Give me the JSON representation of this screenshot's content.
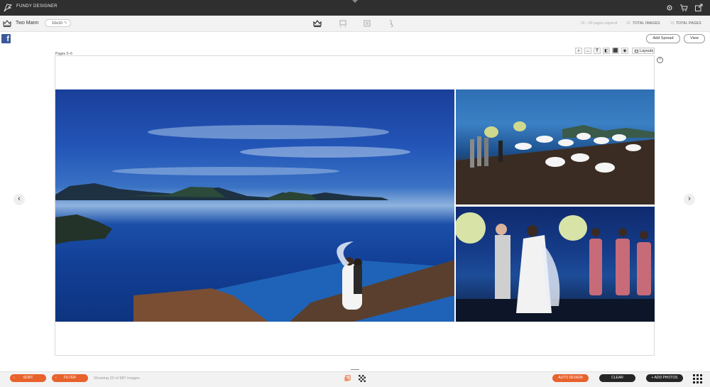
{
  "topbar": {
    "app_title": "FUNDY DESIGNER"
  },
  "project": {
    "name": "Two Mann",
    "size": "10x10"
  },
  "stats": {
    "pages_required": "20 – 80 pages required",
    "total_images_count": "20",
    "total_images_label": "TOTAL IMAGES",
    "total_pages_count": "10",
    "total_pages_label": "TOTAL PAGES"
  },
  "actions": {
    "add_spread": "Add Spread",
    "view": "View"
  },
  "spread": {
    "pages_label": "Pages 5–6",
    "layouts_label": "Layouts"
  },
  "bottom": {
    "sort": "SORT",
    "filter": "FILTER",
    "showing": "Showing 20 of 987 images",
    "auto_design": "AUTO DESIGN",
    "clear": "CLEAR",
    "add_photos": "+ ADD PHOTOS"
  },
  "colors": {
    "accent": "#e8622c",
    "topbar": "#2f2f2f",
    "facebook": "#3b5998"
  }
}
